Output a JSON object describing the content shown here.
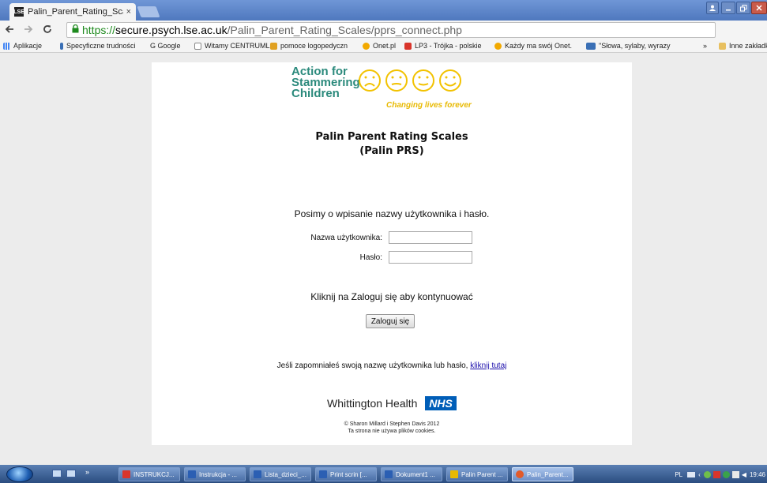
{
  "browser": {
    "tab_title": "Palin_Parent_Rating_Scale",
    "tab_close": "×",
    "url_scheme": "https://",
    "url_host": "secure.psych.lse.ac.uk",
    "url_path": "/Palin_Parent_Rating_Scales/pprs_connect.php",
    "favicon_text": "LSE",
    "bookmarks": [
      {
        "label": "Aplikacje",
        "icon": "apps-grid-icon",
        "color": "#4285f4"
      },
      {
        "label": "Specyficzne trudności",
        "icon": "bookmark-icon",
        "color": "#3a6fb5"
      },
      {
        "label": "G  Google",
        "icon": "google-icon",
        "color": "#4285f4"
      },
      {
        "label": "Witamy CENTRUMLO",
        "icon": "page-icon",
        "color": "#ffffff"
      },
      {
        "label": "pomoce logopedyczn",
        "icon": "bookmark-icon",
        "color": "#e0a020"
      },
      {
        "label": "Onet.pl",
        "icon": "onet-icon",
        "color": "#f2a900"
      },
      {
        "label": "LP3 - Trójka - polskie",
        "icon": "radio-icon",
        "color": "#d9352b"
      },
      {
        "label": "Każdy ma swój Onet.",
        "icon": "onet-icon",
        "color": "#f2a900"
      },
      {
        "label": "\"Słowa, sylaby, wyrazy",
        "icon": "bookmark-icon",
        "color": "#3a6fb5"
      },
      {
        "label": "»",
        "icon": "overflow-icon",
        "color": "#f4f4f4"
      },
      {
        "label": "Inne zakładki",
        "icon": "folder-icon",
        "color": "#e8c060"
      }
    ]
  },
  "page": {
    "logo_text": "Action for\nStammering\nChildren",
    "logo_tagline": "Changing lives forever",
    "title_line1": "Palin Parent Rating Scales",
    "title_line2": "(Palin PRS)",
    "prompt": "Posimy o wpisanie nazwy użytkownika i hasło.",
    "username_label": "Nazwa użytkownika:",
    "username_value": "",
    "password_label": "Hasło:",
    "password_value": "",
    "continue_prompt": "Kliknij na Zaloguj się aby kontynuować",
    "login_button": "Zaloguj się",
    "forgot_text": "Jeśli zapomniałeś swoją nazwę użytkownika lub hasło,",
    "forgot_link": "kliknij tutaj",
    "footer_org": "Whittington Health",
    "footer_nhs": "NHS",
    "copyright": "© Sharon Millard i Stephen Davis 2012",
    "cookies_note": "Ta strona nie używa plików cookies."
  },
  "taskbar": {
    "items": [
      {
        "label": "INSTRUKCJ...",
        "icon_color": "#d9352b",
        "active": false
      },
      {
        "label": "Instrukcja - ...",
        "icon_color": "#2b5fb3",
        "active": false
      },
      {
        "label": "Lista_dzieci_...",
        "icon_color": "#2b5fb3",
        "active": false
      },
      {
        "label": "Print scrin [...",
        "icon_color": "#2b5fb3",
        "active": false
      },
      {
        "label": "Dokument1 ...",
        "icon_color": "#2b5fb3",
        "active": false
      },
      {
        "label": "Palin Parent ...",
        "icon_color": "#e8b900",
        "active": false
      },
      {
        "label": "Palin_Parent...",
        "icon_color": "#e25a2b",
        "active": true
      }
    ],
    "language": "PL",
    "time": "19:46"
  }
}
